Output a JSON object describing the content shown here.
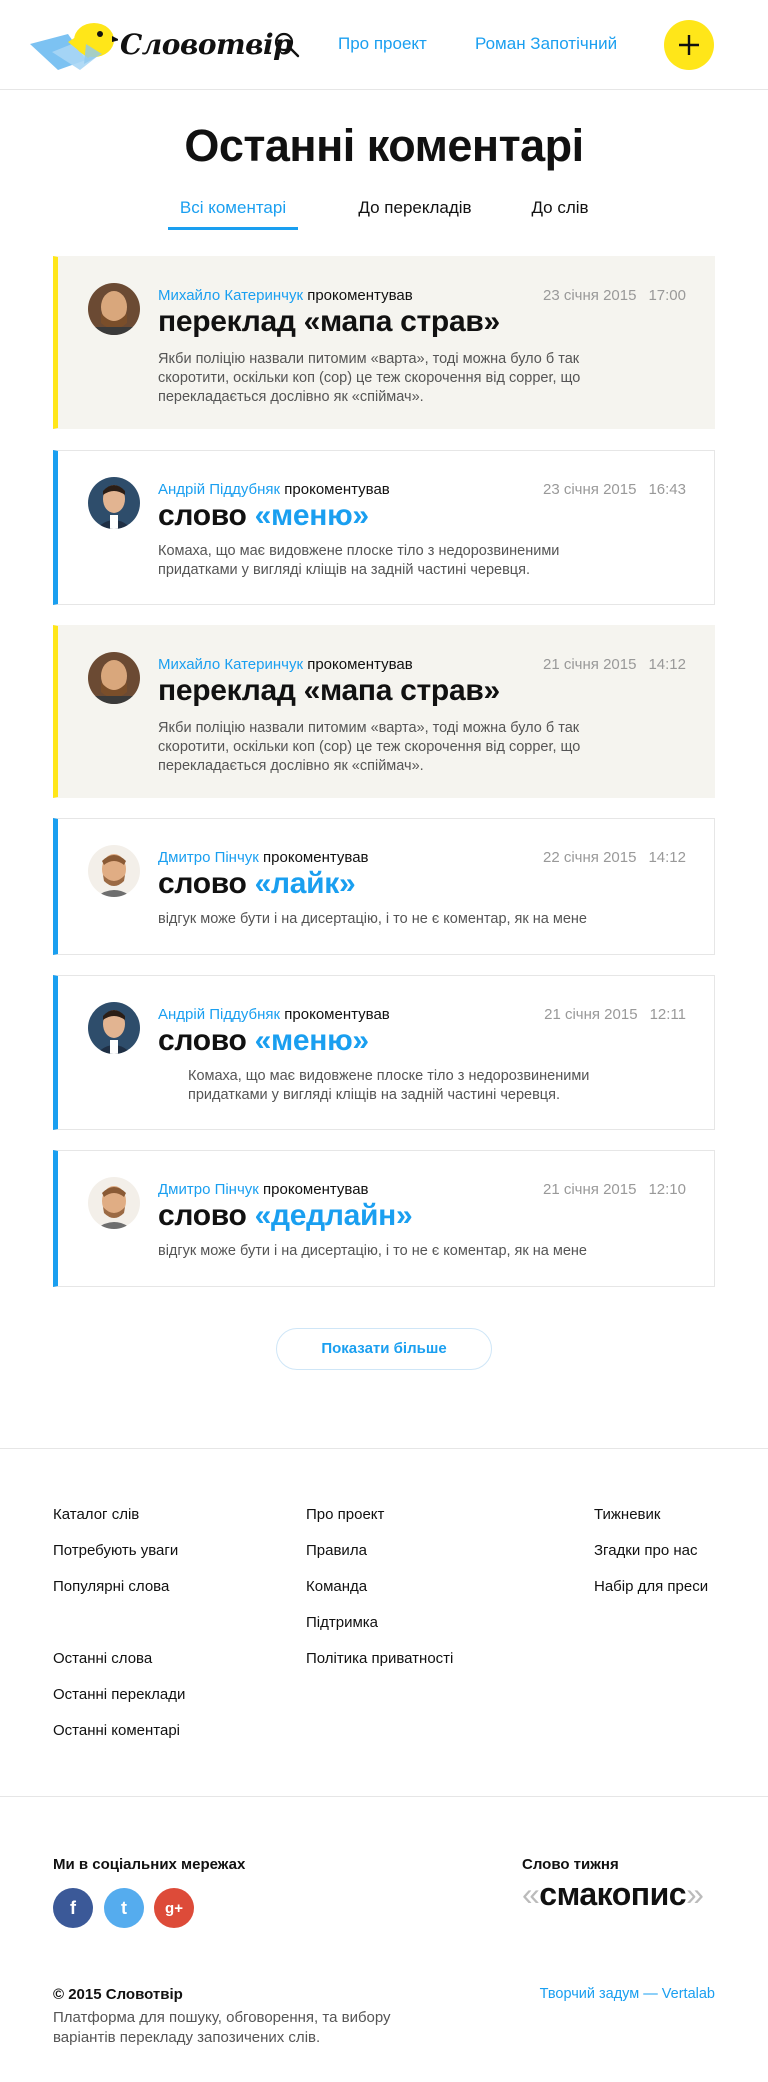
{
  "header": {
    "logo_text": "Словотвір",
    "nav": {
      "about": "Про проект",
      "user": "Роман Запотічний"
    },
    "add_symbol": "+"
  },
  "page_title": "Останні коментарі",
  "tabs": [
    {
      "label": "Всі коментарі",
      "active": true
    },
    {
      "label": "До перекладів",
      "active": false
    },
    {
      "label": "До слів",
      "active": false
    }
  ],
  "comments": [
    {
      "kind": "translation",
      "author": "Михайло Катеринчук",
      "action": "прокоментував",
      "date": "23 січня 2015",
      "time": "17:00",
      "prefix": "переклад",
      "word": "«мапа страв»",
      "text": "Якби поліцію назвали питомим «варта», тоді можна було б так скоротити, оскільки коп (cop) це теж скорочення від copper, що перекладається дослівно як «спіймач»."
    },
    {
      "kind": "word",
      "author": "Андрій Піддубняк",
      "action": "прокоментував",
      "date": "23 січня 2015",
      "time": "16:43",
      "prefix": "слово",
      "word": "«меню»",
      "text": "Комаха, що має видовжене плоске тіло з недорозвиненими придатками у вигляді кліщів на задній частині черевця."
    },
    {
      "kind": "translation",
      "author": "Михайло Катеринчук",
      "action": "прокоментував",
      "date": "21 січня 2015",
      "time": "14:12",
      "prefix": "переклад",
      "word": "«мапа страв»",
      "text": "Якби поліцію назвали питомим «варта», тоді можна було б так скоротити, оскільки коп (cop) це теж скорочення від copper, що перекладається дослівно як «спіймач»."
    },
    {
      "kind": "word",
      "author": "Дмитро Пінчук",
      "action": "прокоментував",
      "date": "22 січня 2015",
      "time": "14:12",
      "prefix": "слово",
      "word": "«лайк»",
      "text": "відгук може бути і на дисертацію, і то не є коментар, як на мене"
    },
    {
      "kind": "word",
      "author": "Андрій Піддубняк",
      "action": "прокоментував",
      "date": "21 січня 2015",
      "time": "12:11",
      "prefix": "слово",
      "word": "«меню»",
      "text": "Комаха, що має видовжене плоске тіло з недорозвиненими придатками у вигляді кліщів на задній частині черевця."
    },
    {
      "kind": "word",
      "author": "Дмитро Пінчук",
      "action": "прокоментував",
      "date": "21 січня 2015",
      "time": "12:10",
      "prefix": "слово",
      "word": "«дедлайн»",
      "text": "відгук може бути і на дисертацію, і то не є коментар, як на мене"
    }
  ],
  "more_button": "Показати більше",
  "footer": {
    "col1": [
      "Каталог слів",
      "Потребують уваги",
      "Популярні слова"
    ],
    "col1b": [
      "Останні слова",
      "Останні переклади",
      "Останні коментарі"
    ],
    "col2": [
      "Про проект",
      "Правила",
      "Команда",
      "Підтримка",
      "Політика приватності"
    ],
    "col3": [
      "Тижневик",
      "Згадки про нас",
      "Набір для преси"
    ],
    "social_heading": "Ми в соціальних мережах",
    "social": {
      "facebook": "f",
      "twitter": "t",
      "gplus": "g+"
    },
    "word_of_week_heading": "Слово тижня",
    "word_of_week": "смакопис",
    "copyright": "© 2015 Словотвір",
    "tagline": "Платформа для пошуку, обговорення, та вибору варіантів перекладу запозичених слів.",
    "credit": "Творчий задум — Vertalab"
  },
  "colors": {
    "accent": "#1a9ff0",
    "yellow": "#ffe619",
    "translation_bg": "#f5f4ef"
  }
}
